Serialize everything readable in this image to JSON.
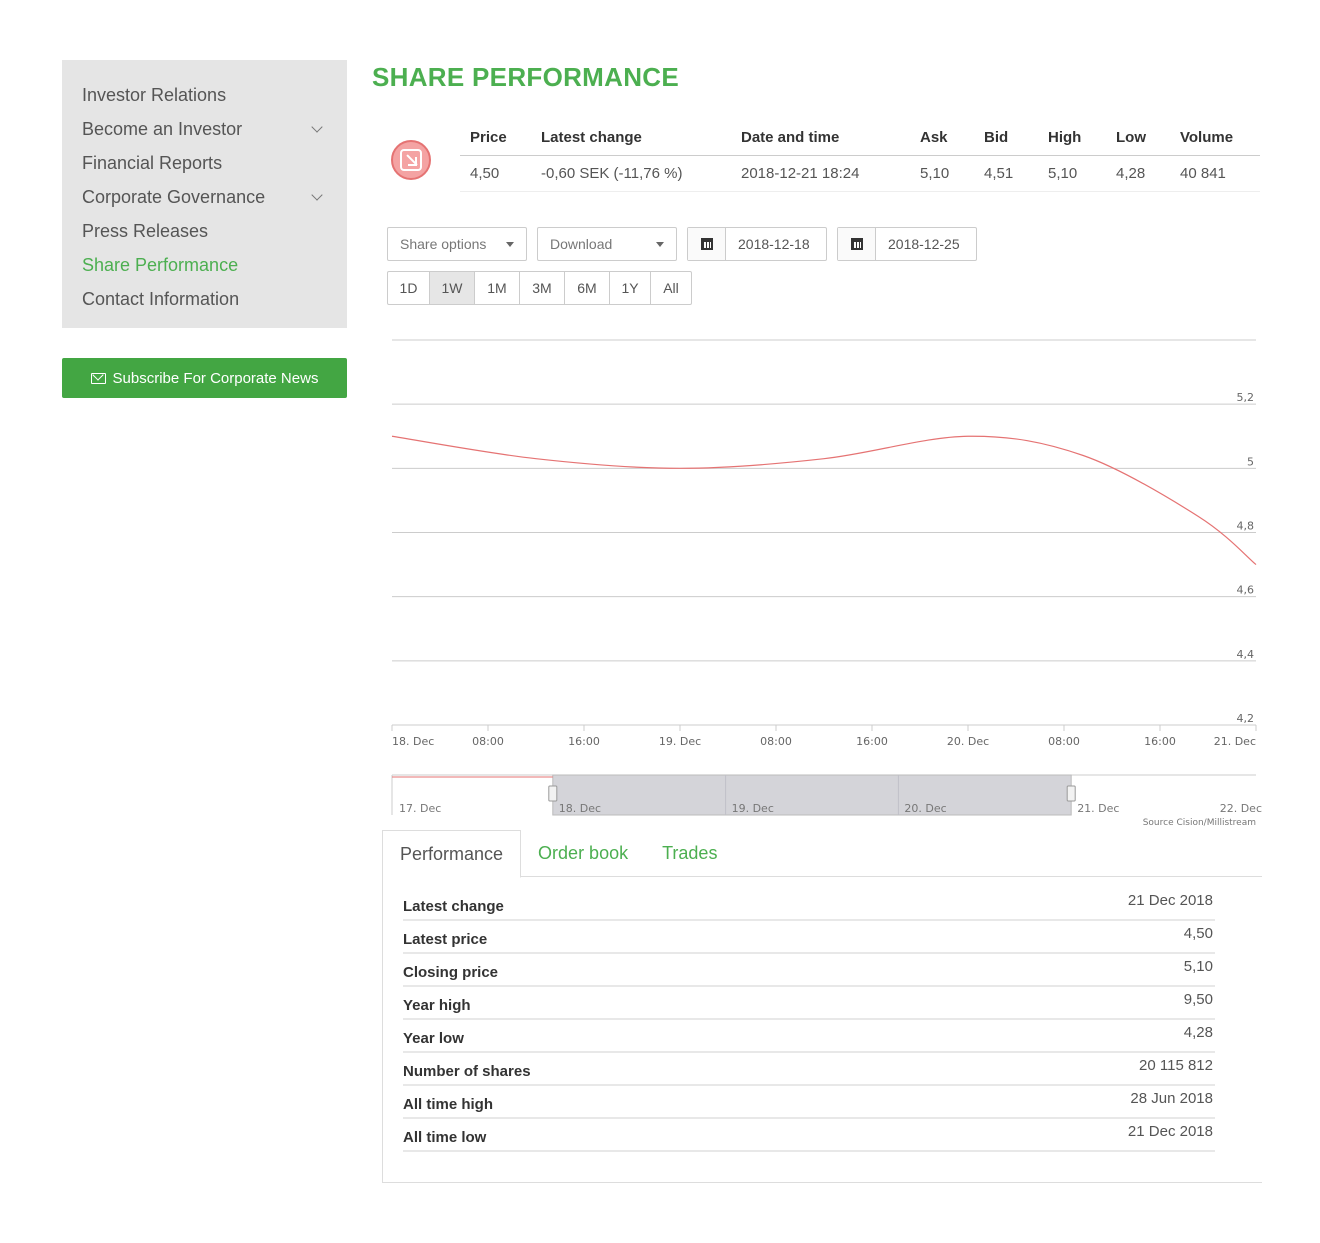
{
  "sidebar": {
    "items": [
      {
        "label": "Investor Relations",
        "has_submenu": false,
        "active": false
      },
      {
        "label": "Become an Investor",
        "has_submenu": true,
        "active": false
      },
      {
        "label": "Financial Reports",
        "has_submenu": false,
        "active": false
      },
      {
        "label": "Corporate Governance",
        "has_submenu": true,
        "active": false
      },
      {
        "label": "Press Releases",
        "has_submenu": false,
        "active": false
      },
      {
        "label": "Share Performance",
        "has_submenu": false,
        "active": true
      },
      {
        "label": "Contact Information",
        "has_submenu": false,
        "active": false
      }
    ],
    "subscribe_label": "Subscribe For Corporate News"
  },
  "page": {
    "title": "SHARE PERFORMANCE"
  },
  "quote": {
    "trend_icon": "arrow-down-right-icon",
    "headers": [
      "Price",
      "Latest change",
      "Date and time",
      "Ask",
      "Bid",
      "High",
      "Low",
      "Volume"
    ],
    "values": [
      "4,50",
      "-0,60 SEK (-11,76 %)",
      "2018-12-21 18:24",
      "5,10",
      "4,51",
      "5,10",
      "4,28",
      "40 841"
    ]
  },
  "controls": {
    "share_options": "Share options",
    "download": "Download",
    "date_from": "2018-12-18",
    "date_to": "2018-12-25",
    "ranges": [
      "1D",
      "1W",
      "1M",
      "3M",
      "6M",
      "1Y",
      "All"
    ],
    "active_range": "1W"
  },
  "chart_data": {
    "type": "line",
    "y_ticks": [
      "5,2",
      "5",
      "4,8",
      "4,6",
      "4,4",
      "4,2"
    ],
    "ylim": [
      4.2,
      5.4
    ],
    "x_ticks": [
      "18. Dec",
      "08:00",
      "16:00",
      "19. Dec",
      "08:00",
      "16:00",
      "20. Dec",
      "08:00",
      "16:00",
      "21. Dec"
    ],
    "series": [
      {
        "color": "#e57373",
        "points": [
          {
            "t": 0,
            "v": 5.1
          },
          {
            "t": 0.5,
            "v": 5.03
          },
          {
            "t": 1.0,
            "v": 5.0
          },
          {
            "t": 1.5,
            "v": 5.03
          },
          {
            "t": 2.0,
            "v": 5.1
          },
          {
            "t": 2.4,
            "v": 5.04
          },
          {
            "t": 2.8,
            "v": 4.85
          },
          {
            "t": 3.0,
            "v": 4.7
          }
        ]
      }
    ],
    "navigator_ticks": [
      "17. Dec",
      "18. Dec",
      "19. Dec",
      "20. Dec",
      "21. Dec",
      "22. Dec"
    ],
    "source": "Source Cision/Millistream",
    "line_color": "#e57373"
  },
  "tabs": {
    "items": [
      "Performance",
      "Order book",
      "Trades"
    ],
    "active": "Performance"
  },
  "performance": [
    {
      "label": "Latest change",
      "value": "21 Dec 2018"
    },
    {
      "label": "Latest price",
      "value": "4,50"
    },
    {
      "label": "Closing price",
      "value": "5,10"
    },
    {
      "label": "Year high",
      "value": "9,50"
    },
    {
      "label": "Year low",
      "value": "4,28"
    },
    {
      "label": "Number of shares",
      "value": "20 115 812"
    },
    {
      "label": "All time high",
      "value": "28 Jun 2018"
    },
    {
      "label": "All time low",
      "value": "21 Dec 2018"
    }
  ],
  "colors": {
    "accent": "#4caf50",
    "subscribe_bg": "#43a643",
    "sidebar_bg": "#e5e5e5",
    "down": "#e57373"
  }
}
